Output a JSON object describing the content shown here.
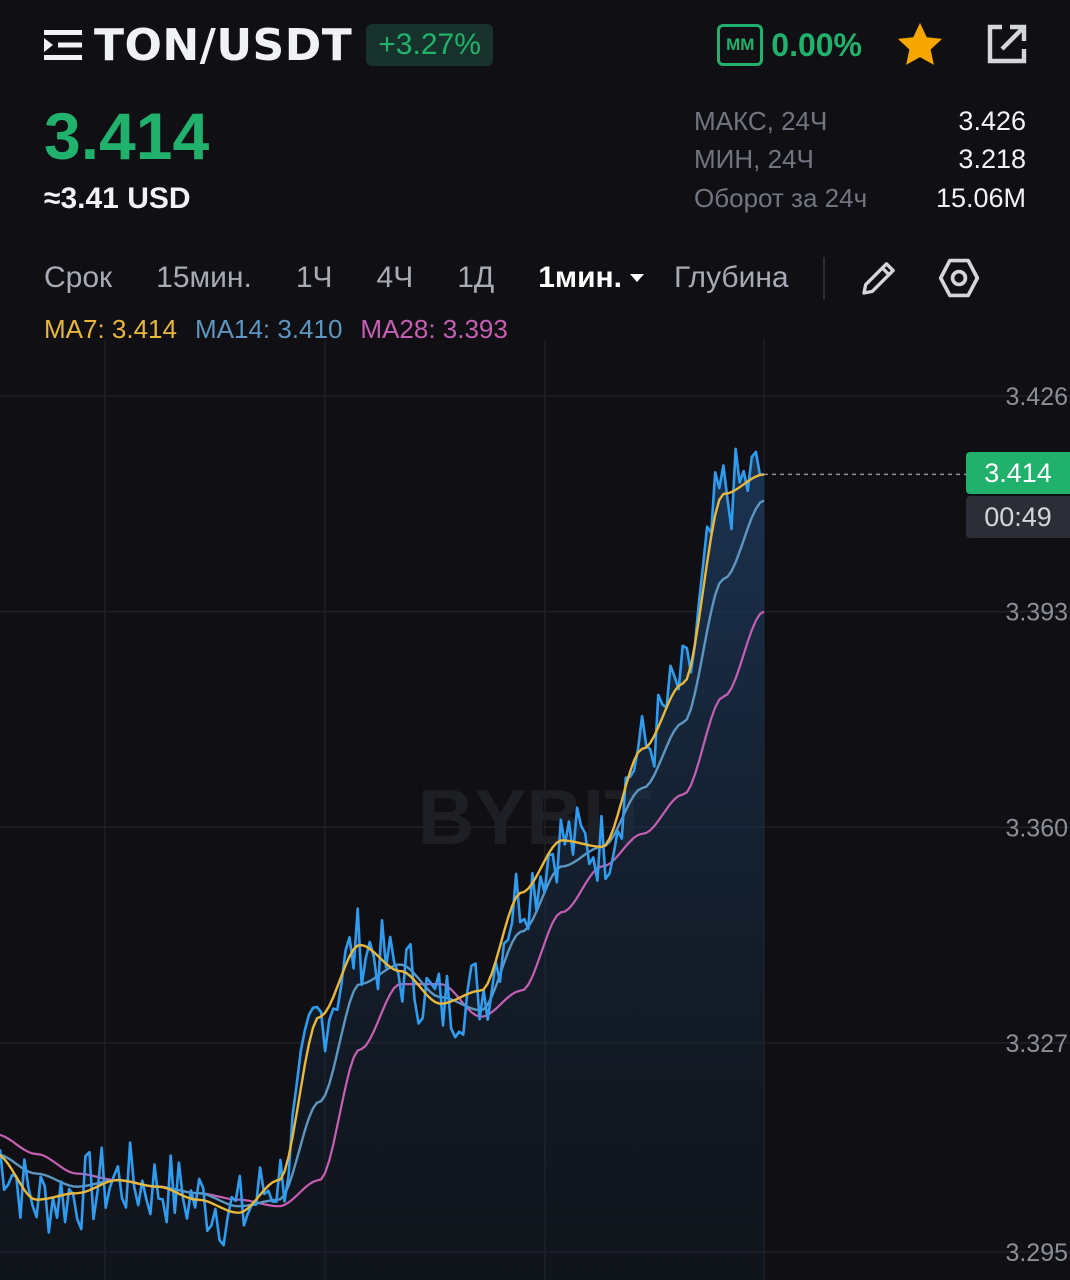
{
  "header": {
    "pair": "TON/USDT",
    "change": "+3.27%",
    "mm_label": "MM",
    "mm_value": "0.00%",
    "icons": [
      "menu-icon",
      "star-icon",
      "share-icon"
    ]
  },
  "price": {
    "last": "3.414",
    "usd": "≈3.41 USD"
  },
  "stats": [
    {
      "label": "МАКС, 24Ч",
      "value": "3.426"
    },
    {
      "label": "МИН, 24Ч",
      "value": "3.218"
    },
    {
      "label": "Оборот за 24ч",
      "value": "15.06M"
    }
  ],
  "tabs": {
    "items": [
      "Срок",
      "15мин.",
      "1Ч",
      "4Ч",
      "1Д"
    ],
    "active": "1мин.",
    "depth": "Глубина"
  },
  "ma_legend": {
    "ma7": "MA7: 3.414",
    "ma14": "MA14: 3.410",
    "ma28": "MA28: 3.393"
  },
  "colors": {
    "up": "#20b26c",
    "price_line": "#2f9cf0",
    "ma7": "#e8b73c",
    "ma14": "#5d96c0",
    "ma28": "#c65fb4",
    "background": "#101014"
  },
  "chart_data": {
    "type": "line",
    "y_ticks": [
      "3.426",
      "3.393",
      "3.360",
      "3.327",
      "3.295"
    ],
    "ylim": [
      3.295,
      3.426
    ],
    "current_price_label": "3.414",
    "countdown_label": "00:49",
    "watermark": "BYBIT",
    "series": [
      {
        "name": "MA7",
        "values": [
          3.31,
          3.303,
          3.304,
          3.306,
          3.305,
          3.303,
          3.301,
          3.306,
          3.331,
          3.342,
          3.338,
          3.333,
          3.335,
          3.35,
          3.358,
          3.357,
          3.372,
          3.382,
          3.411,
          3.414
        ]
      },
      {
        "name": "MA14",
        "values": [
          3.31,
          3.307,
          3.305,
          3.306,
          3.305,
          3.304,
          3.302,
          3.303,
          3.318,
          3.336,
          3.339,
          3.334,
          3.332,
          3.344,
          3.354,
          3.357,
          3.366,
          3.376,
          3.398,
          3.41
        ]
      },
      {
        "name": "MA28",
        "values": [
          3.313,
          3.31,
          3.307,
          3.306,
          3.305,
          3.304,
          3.303,
          3.302,
          3.306,
          3.326,
          3.336,
          3.336,
          3.331,
          3.335,
          3.347,
          3.354,
          3.359,
          3.365,
          3.38,
          3.393
        ]
      }
    ]
  }
}
